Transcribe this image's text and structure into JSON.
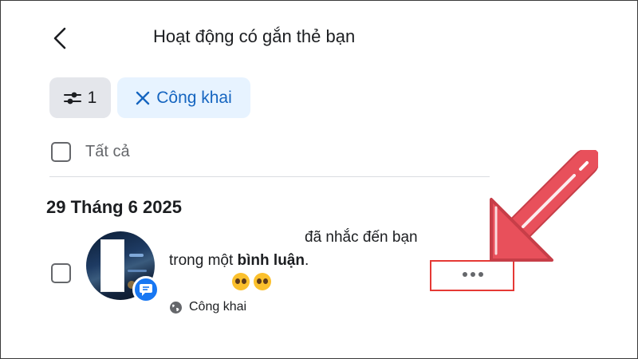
{
  "header": {
    "title": "Hoạt động có gắn thẻ bạn"
  },
  "filters": {
    "count_label": "1",
    "privacy_chip_label": "Công khai"
  },
  "select_all": {
    "label": "Tất cả"
  },
  "date_section": {
    "date": "29 Tháng 6 2025"
  },
  "notification": {
    "line1": "đã nhắc đến bạn",
    "line2_prefix": "trong một ",
    "line2_bold": "bình luận",
    "line2_suffix": ".",
    "emojis": [
      "pleading-face",
      "pleading-face"
    ],
    "privacy_label": "Công khai"
  },
  "colors": {
    "accent_blue": "#1877f2",
    "chip_text": "#1565c0",
    "chip_bg": "#e7f3ff",
    "filter_bg": "#e4e6eb",
    "highlight_red": "#e53935",
    "arrow_red": "#e8505b"
  },
  "icons": {
    "back": "chevron-left-icon",
    "filter": "sliders-icon",
    "close": "close-icon",
    "comment": "comment-icon",
    "globe": "globe-icon",
    "more": "more-horizontal-icon",
    "annotation": "arrow-pointer-icon"
  }
}
